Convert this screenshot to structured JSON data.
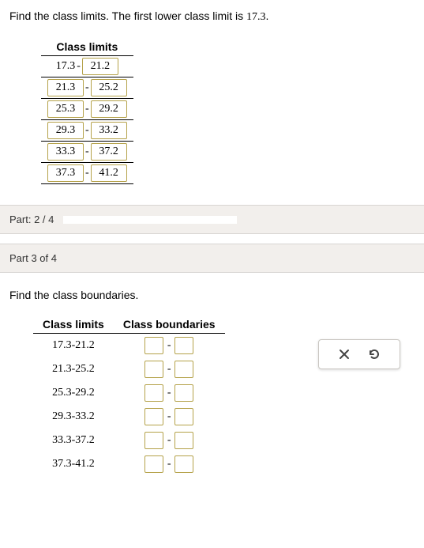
{
  "problem1": {
    "prefix": "Find the class limits. The first lower class limit is ",
    "start_value": "17.3",
    "suffix": "."
  },
  "table1": {
    "header": "Class limits",
    "rows": [
      {
        "lower": "17.3",
        "upper": "21.2"
      },
      {
        "lower": "21.3",
        "upper": "25.2"
      },
      {
        "lower": "25.3",
        "upper": "29.2"
      },
      {
        "lower": "29.3",
        "upper": "33.2"
      },
      {
        "lower": "33.3",
        "upper": "37.2"
      },
      {
        "lower": "37.3",
        "upper": "41.2"
      }
    ]
  },
  "progress": {
    "label_prefix": "Part: ",
    "current": "2",
    "sep": " / ",
    "total": "4"
  },
  "part3": {
    "header": "Part 3 of 4"
  },
  "problem2": {
    "text": "Find the class boundaries."
  },
  "table2": {
    "header_limits": "Class limits",
    "header_boundaries": "Class boundaries",
    "rows": [
      {
        "limits": "17.3-21.2"
      },
      {
        "limits": "21.3-25.2"
      },
      {
        "limits": "25.3-29.2"
      },
      {
        "limits": "29.3-33.2"
      },
      {
        "limits": "33.3-37.2"
      },
      {
        "limits": "37.3-41.2"
      }
    ]
  },
  "dash": "-"
}
